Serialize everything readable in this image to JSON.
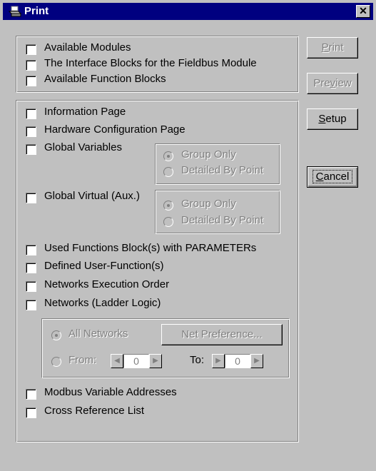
{
  "window": {
    "title": "Print",
    "close_glyph": "✕"
  },
  "top_checkboxes": [
    {
      "label": "Available Modules",
      "checked": false
    },
    {
      "label": "The Interface Blocks for the Fieldbus Module",
      "checked": false
    },
    {
      "label": "Available Function Blocks",
      "checked": false
    }
  ],
  "main_checkboxes": {
    "information_page": "Information Page",
    "hardware_configuration_page": "Hardware Configuration Page",
    "global_variables": "Global Variables",
    "global_virtual": "Global Virtual (Aux.)",
    "used_function_blocks": "Used Functions Block(s) with PARAMETERs",
    "defined_user_functions": "Defined User-Function(s)",
    "networks_execution_order": "Networks Execution Order",
    "networks_ladder_logic": "Networks (Ladder Logic)",
    "modbus_variable_addresses": "Modbus Variable Addresses",
    "cross_reference_list": "Cross Reference List"
  },
  "global_variables_options": {
    "group_only": "Group Only",
    "detailed_by_point": "Detailed By Point",
    "selected": "Group Only"
  },
  "global_virtual_options": {
    "group_only": "Group Only",
    "detailed_by_point": "Detailed By Point",
    "selected": "Group Only"
  },
  "networks_options": {
    "all_networks": "All Networks",
    "from": "From:",
    "to": "To:",
    "from_value": "0",
    "to_value": "0",
    "net_preference": "Net Preference...",
    "selected": "All Networks"
  },
  "buttons": {
    "print": {
      "before": "",
      "key": "P",
      "after": "rint",
      "enabled": false
    },
    "preview": {
      "before": "Pre",
      "key": "v",
      "after": "iew",
      "enabled": false
    },
    "setup": {
      "before": "",
      "key": "S",
      "after": "etup",
      "enabled": true
    },
    "cancel": {
      "before": "",
      "key": "C",
      "after": "ancel",
      "enabled": true
    }
  },
  "colors": {
    "titlebar": "#000080",
    "face": "#c0c0c0",
    "disabled_text": "#808080"
  }
}
